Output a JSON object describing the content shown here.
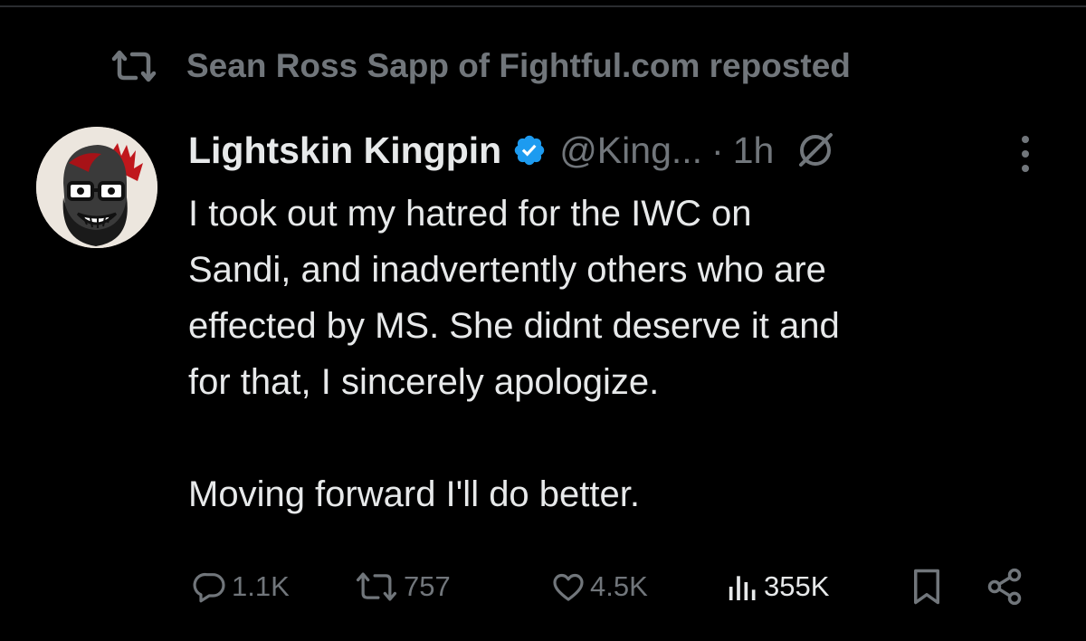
{
  "repost": {
    "text": "Sean Ross Sapp of Fightful.com reposted",
    "icon": "repost-icon"
  },
  "author": {
    "name": "Lightskin Kingpin",
    "handle": "@King...",
    "separator": "·",
    "time": "1h",
    "avatar_icon": "avatar-illustration",
    "verified_icon": "verified-badge-icon",
    "verified_color": "#1d9bf0"
  },
  "tweet": {
    "lines": [
      "I took out my hatred for the IWC on",
      "Sandi, and inadvertently others who are",
      "effected by MS. She didnt deserve it and",
      "for that, I sincerely apologize."
    ],
    "closing": "Moving forward I'll do better."
  },
  "actions": {
    "replies": "1.1K",
    "reposts": "757",
    "likes": "4.5K",
    "views": "355K"
  },
  "colors": {
    "background": "#000000",
    "text": "#e7e9ea",
    "muted": "#71767b"
  }
}
